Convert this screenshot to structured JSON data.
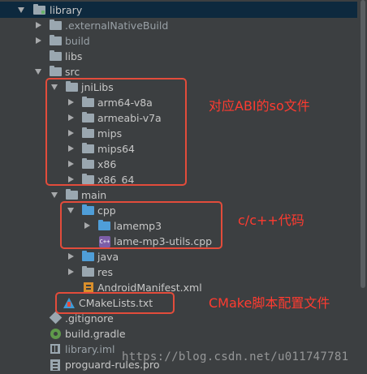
{
  "tree": {
    "items": [
      {
        "label": "library",
        "indent": 0,
        "arrow": "down",
        "icon": "module-folder-icon",
        "selected": true
      },
      {
        "label": ".externalNativeBuild",
        "indent": 1,
        "arrow": "right",
        "icon": "folder-icon"
      },
      {
        "label": "build",
        "indent": 1,
        "arrow": "right",
        "icon": "folder-icon"
      },
      {
        "label": "libs",
        "indent": 1,
        "arrow": "none",
        "icon": "folder-icon"
      },
      {
        "label": "src",
        "indent": 1,
        "arrow": "down",
        "icon": "folder-icon"
      },
      {
        "label": "jniLibs",
        "indent": 2,
        "arrow": "down",
        "icon": "folder-icon"
      },
      {
        "label": "arm64-v8a",
        "indent": 3,
        "arrow": "right",
        "icon": "folder-icon"
      },
      {
        "label": "armeabi-v7a",
        "indent": 3,
        "arrow": "right",
        "icon": "folder-icon"
      },
      {
        "label": "mips",
        "indent": 3,
        "arrow": "right",
        "icon": "folder-icon"
      },
      {
        "label": "mips64",
        "indent": 3,
        "arrow": "right",
        "icon": "folder-icon"
      },
      {
        "label": "x86",
        "indent": 3,
        "arrow": "right",
        "icon": "folder-icon"
      },
      {
        "label": "x86_64",
        "indent": 3,
        "arrow": "right",
        "icon": "folder-icon"
      },
      {
        "label": "main",
        "indent": 2,
        "arrow": "down",
        "icon": "folder-icon"
      },
      {
        "label": "cpp",
        "indent": 3,
        "arrow": "down",
        "icon": "blue-folder-icon"
      },
      {
        "label": "lamemp3",
        "indent": 4,
        "arrow": "right",
        "icon": "blue-folder-icon"
      },
      {
        "label": "lame-mp3-utils.cpp",
        "indent": 4,
        "arrow": "none",
        "icon": "cpp-file-icon"
      },
      {
        "label": "java",
        "indent": 3,
        "arrow": "right",
        "icon": "blue-folder-icon"
      },
      {
        "label": "res",
        "indent": 3,
        "arrow": "right",
        "icon": "res-folder-icon"
      },
      {
        "label": "AndroidManifest.xml",
        "indent": 3,
        "arrow": "none",
        "icon": "manifest-icon"
      },
      {
        "label": "CMakeLists.txt",
        "indent": 2,
        "arrow": "none",
        "icon": "cmake-icon"
      },
      {
        "label": ".gitignore",
        "indent": 1,
        "arrow": "none",
        "icon": "git-icon"
      },
      {
        "label": "build.gradle",
        "indent": 1,
        "arrow": "none",
        "icon": "gradle-icon"
      },
      {
        "label": "library.iml",
        "indent": 1,
        "arrow": "none",
        "icon": "iml-icon"
      },
      {
        "label": "proguard-rules.pro",
        "indent": 1,
        "arrow": "none",
        "icon": "pro-icon"
      }
    ]
  },
  "annotations": {
    "abi": "对应ABI的so文件",
    "cpp": "c/c++代码",
    "cmake": "CMake脚本配置文件",
    "watermark": "https://blog.csdn.net/u011747781"
  },
  "colors": {
    "background": "#3c3f41",
    "selected_row": "#0d293e",
    "folder": "#9aa7b0",
    "source_folder": "#4f9ed8",
    "annotation": "#ff3b30",
    "annotation_box": "#e34c3b"
  }
}
